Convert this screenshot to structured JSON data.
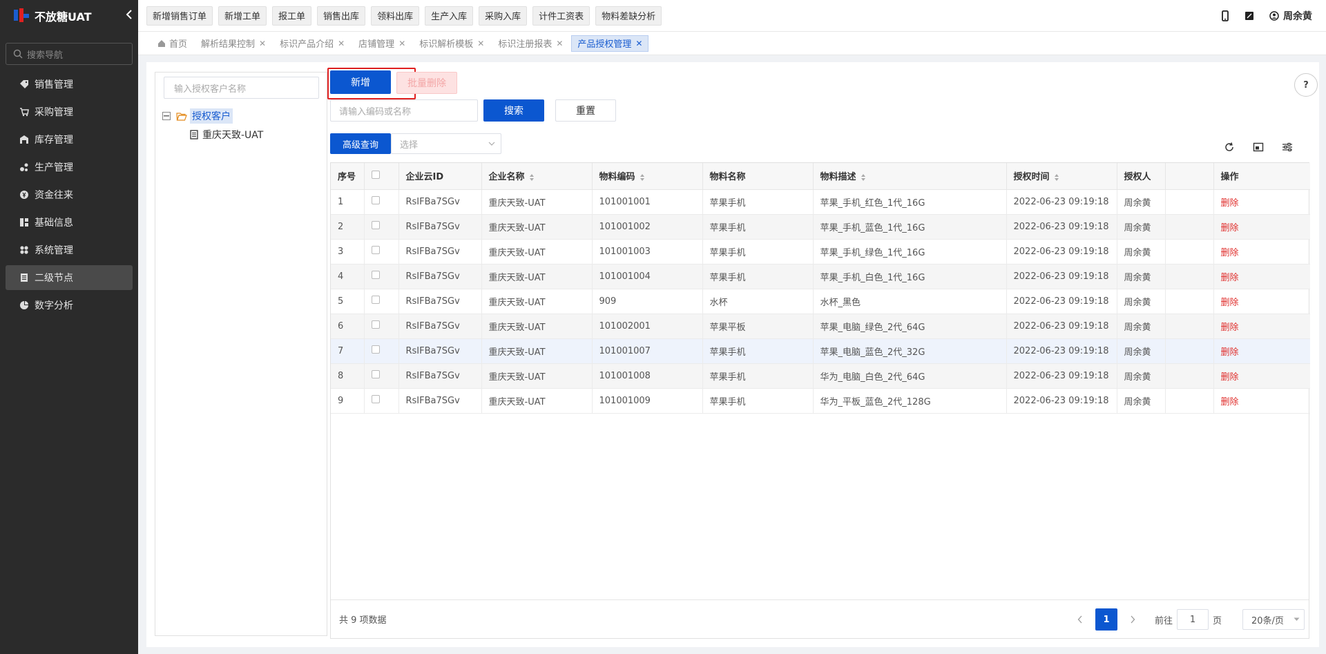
{
  "app": {
    "title": "不放糖UAT",
    "brand_colors": [
      "#1a5dd0",
      "#e02020"
    ]
  },
  "sidebar": {
    "search_placeholder": "搜索导航",
    "items": [
      {
        "label": "销售管理",
        "icon": "tag-icon"
      },
      {
        "label": "采购管理",
        "icon": "cart-icon"
      },
      {
        "label": "库存管理",
        "icon": "warehouse-icon"
      },
      {
        "label": "生产管理",
        "icon": "production-icon"
      },
      {
        "label": "资金往来",
        "icon": "money-icon"
      },
      {
        "label": "基础信息",
        "icon": "info-icon"
      },
      {
        "label": "系统管理",
        "icon": "settings-icon"
      },
      {
        "label": "二级节点",
        "icon": "document-icon",
        "active": true
      },
      {
        "label": "数字分析",
        "icon": "pie-chart-icon"
      }
    ]
  },
  "quick_buttons": [
    "新增销售订单",
    "新增工单",
    "报工单",
    "销售出库",
    "领料出库",
    "生产入库",
    "采购入库",
    "计件工资表",
    "物料差缺分析"
  ],
  "user": {
    "name": "周余黄"
  },
  "tabs": [
    {
      "label": "首页",
      "closable": false
    },
    {
      "label": "解析结果控制",
      "closable": true
    },
    {
      "label": "标识产品介绍",
      "closable": true
    },
    {
      "label": "店铺管理",
      "closable": true
    },
    {
      "label": "标识解析模板",
      "closable": true
    },
    {
      "label": "标识注册报表",
      "closable": true
    },
    {
      "label": "产品授权管理",
      "closable": true,
      "active": true
    }
  ],
  "tree": {
    "search_placeholder": "输入授权客户名称",
    "root": "授权客户",
    "children": [
      "重庆天致-UAT"
    ]
  },
  "toolbar": {
    "add_label": "新增",
    "batch_delete_label": "批量删除",
    "search_placeholder": "请输入编码或名称",
    "search_label": "搜索",
    "reset_label": "重置",
    "advanced_label": "高级查询",
    "select_placeholder": "选择"
  },
  "table": {
    "columns": [
      "序号",
      "",
      "企业云ID",
      "企业名称",
      "物料编码",
      "物料名称",
      "物料描述",
      "授权时间",
      "授权人",
      "",
      "操作"
    ],
    "rows": [
      [
        "1",
        "RsIFBa7SGv",
        "重庆天致-UAT",
        "101001001",
        "苹果手机",
        "苹果_手机_红色_1代_16G",
        "2022-06-23 09:19:18",
        "周余黄",
        "删除"
      ],
      [
        "2",
        "RsIFBa7SGv",
        "重庆天致-UAT",
        "101001002",
        "苹果手机",
        "苹果_手机_蓝色_1代_16G",
        "2022-06-23 09:19:18",
        "周余黄",
        "删除"
      ],
      [
        "3",
        "RsIFBa7SGv",
        "重庆天致-UAT",
        "101001003",
        "苹果手机",
        "苹果_手机_绿色_1代_16G",
        "2022-06-23 09:19:18",
        "周余黄",
        "删除"
      ],
      [
        "4",
        "RsIFBa7SGv",
        "重庆天致-UAT",
        "101001004",
        "苹果手机",
        "苹果_手机_白色_1代_16G",
        "2022-06-23 09:19:18",
        "周余黄",
        "删除"
      ],
      [
        "5",
        "RsIFBa7SGv",
        "重庆天致-UAT",
        "909",
        "水杯",
        "水杯_黑色",
        "2022-06-23 09:19:18",
        "周余黄",
        "删除"
      ],
      [
        "6",
        "RsIFBa7SGv",
        "重庆天致-UAT",
        "101002001",
        "苹果平板",
        "苹果_电脑_绿色_2代_64G",
        "2022-06-23 09:19:18",
        "周余黄",
        "删除"
      ],
      [
        "7",
        "RsIFBa7SGv",
        "重庆天致-UAT",
        "101001007",
        "苹果手机",
        "苹果_电脑_蓝色_2代_32G",
        "2022-06-23 09:19:18",
        "周余黄",
        "删除"
      ],
      [
        "8",
        "RsIFBa7SGv",
        "重庆天致-UAT",
        "101001008",
        "苹果手机",
        "华为_电脑_白色_2代_64G",
        "2022-06-23 09:19:18",
        "周余黄",
        "删除"
      ],
      [
        "9",
        "RsIFBa7SGv",
        "重庆天致-UAT",
        "101001009",
        "苹果手机",
        "华为_平板_蓝色_2代_128G",
        "2022-06-23 09:19:18",
        "周余黄",
        "删除"
      ]
    ]
  },
  "footer": {
    "total": "共 9 项数据",
    "current_page": "1",
    "goto_label": "前往",
    "goto_value": "1",
    "page_unit": "页",
    "page_size": "20条/页"
  }
}
